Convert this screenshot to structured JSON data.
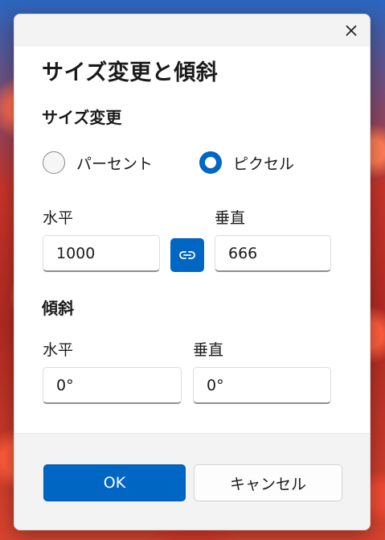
{
  "dialog": {
    "title": "サイズ変更と傾斜",
    "close_label": "×"
  },
  "resize": {
    "section_title": "サイズ変更",
    "mode_options": [
      {
        "label": "パーセント",
        "selected": false
      },
      {
        "label": "ピクセル",
        "selected": true
      }
    ],
    "horizontal_label": "水平",
    "horizontal_value": "1000",
    "vertical_label": "垂直",
    "vertical_value": "666",
    "aspect_lock": {
      "icon": "link-icon",
      "active": true
    }
  },
  "skew": {
    "section_title": "傾斜",
    "horizontal_label": "水平",
    "horizontal_value": "0°",
    "vertical_label": "垂直",
    "vertical_value": "0°"
  },
  "footer": {
    "ok_label": "OK",
    "cancel_label": "キャンセル"
  },
  "colors": {
    "accent": "#0066c4",
    "dialog_bg": "#ffffff",
    "footer_bg": "#f3f3f3"
  }
}
